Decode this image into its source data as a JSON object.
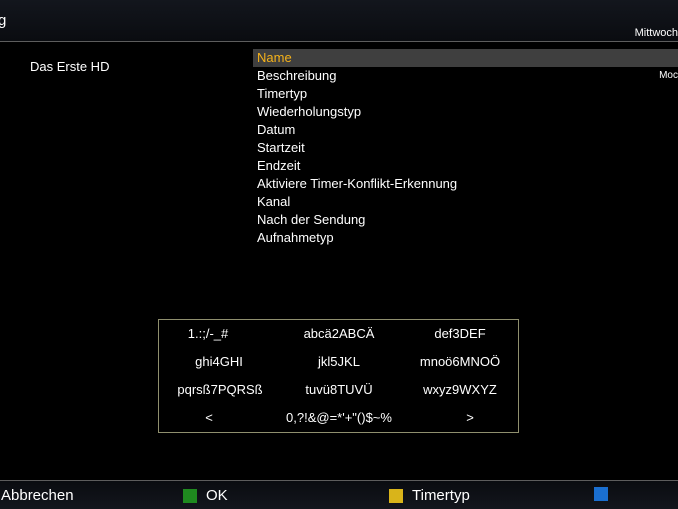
{
  "header": {
    "title": "g",
    "clock": "Mittwoch"
  },
  "service": {
    "name": "Das Erste HD"
  },
  "menu": {
    "items": [
      {
        "label": "Name",
        "selected": true
      },
      {
        "label": "Beschreibung"
      },
      {
        "label": "Timertyp"
      },
      {
        "label": "Wiederholungstyp"
      },
      {
        "label": "Datum"
      },
      {
        "label": "Startzeit"
      },
      {
        "label": "Endzeit"
      },
      {
        "label": "Aktiviere Timer-Konflikt-Erkennung"
      },
      {
        "label": "Kanal"
      },
      {
        "label": "Nach der Sendung"
      },
      {
        "label": "Aufnahmetyp"
      }
    ],
    "description_value": "Moc"
  },
  "keyboard": {
    "rows": [
      [
        "1.:;/-_#",
        "abcä2ABCÄ",
        "def3DEF"
      ],
      [
        "ghi4GHI",
        "jkl5JKL",
        "mnoö6MNOÖ"
      ],
      [
        "pqrsß7PQRSß",
        "tuvü8TUVÜ",
        "wxyz9WXYZ"
      ],
      [
        "<",
        "0,?!&@=*'+\"()$~%",
        ">"
      ]
    ]
  },
  "footer": {
    "red_label": "Abbrechen",
    "green_label": "OK",
    "yellow_label": "Timertyp",
    "blue_label": "",
    "colors": {
      "green": "#1f8a1f",
      "yellow": "#d9b41a",
      "blue": "#1a6fd0",
      "selected_text": "#f5b21a"
    }
  }
}
